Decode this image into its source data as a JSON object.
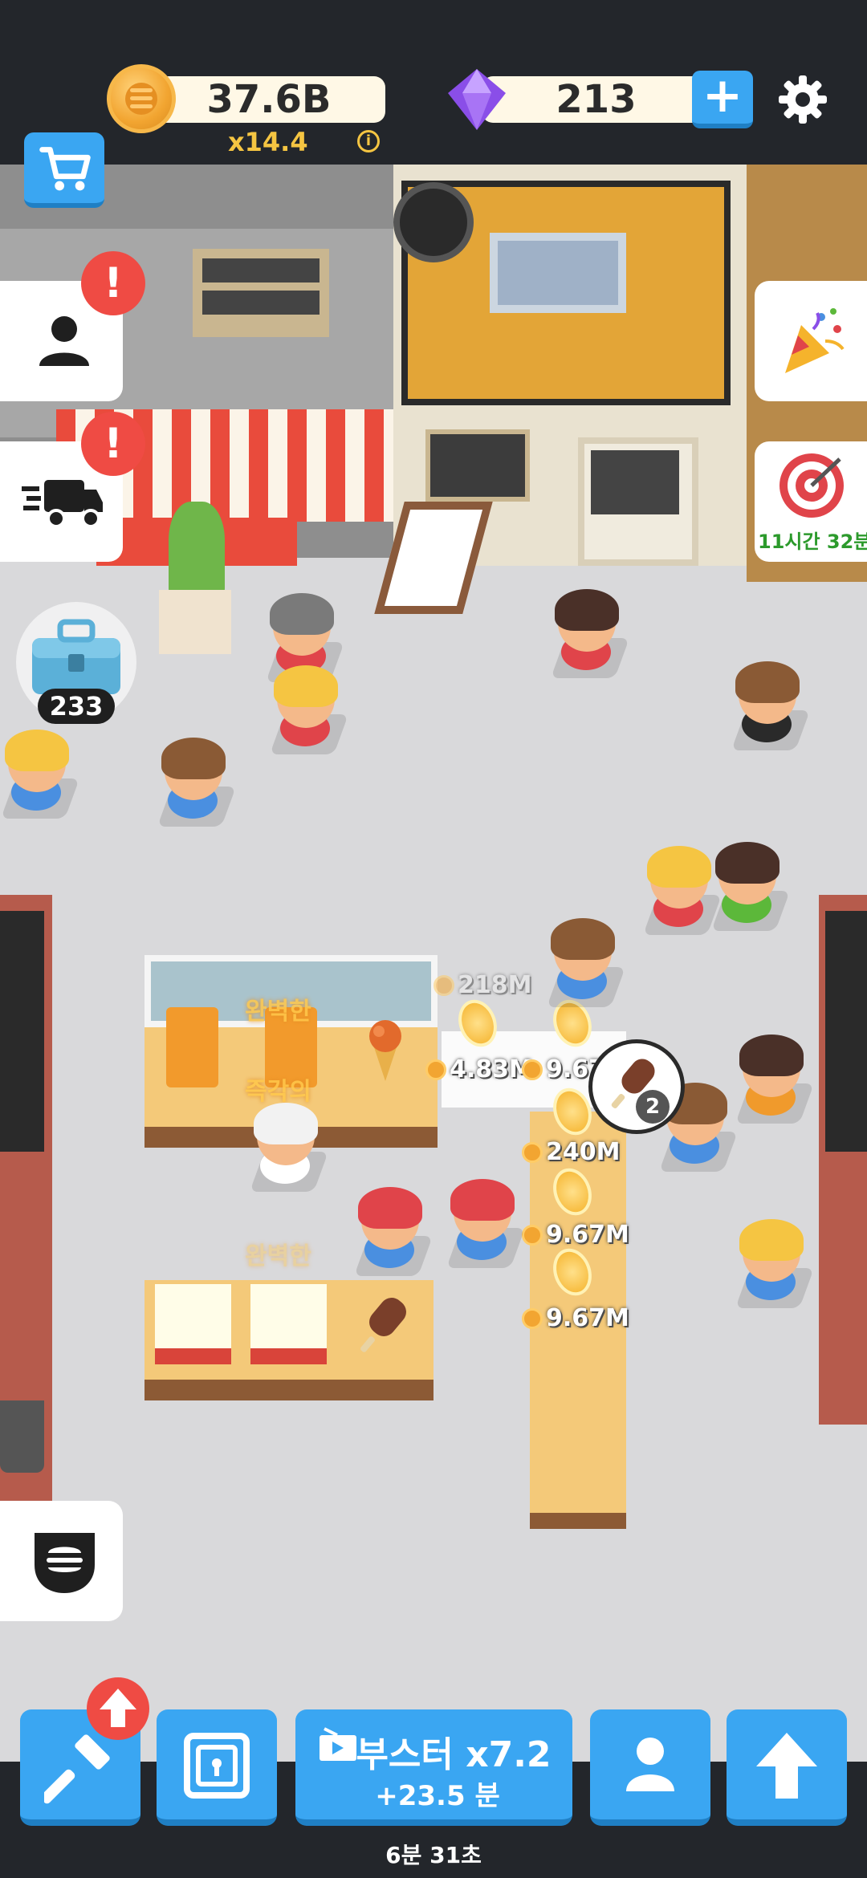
{
  "hud": {
    "coins": "37.6B",
    "multiplier": "x14.4",
    "info_symbol": "i",
    "gems": "213",
    "plus_label": "+"
  },
  "side_left": {
    "chest_count": "233"
  },
  "side_right": {
    "event_timer": "11시간 32분"
  },
  "scene": {
    "floating_texts": [
      "완벽한",
      "즉각의",
      "완벽한"
    ],
    "coin_labels": {
      "top_dim": "218M",
      "left_pile": "4.83M",
      "right_pile_1": "9.67M",
      "right_pile_2": "240M",
      "right_pile_3": "9.67M",
      "right_pile_4": "9.67M"
    },
    "order_count": "2"
  },
  "bottom": {
    "booster_label": "부스터 x7.2",
    "booster_time": "+23.5 분",
    "booster_countdown": "6분 31초"
  },
  "colors": {
    "accent_blue": "#3aa6f2",
    "alert_red": "#ef4b44",
    "coin_gold": "#f5c542",
    "background": "#23262b"
  },
  "icons": [
    "cart-icon",
    "settings-gear-icon",
    "gem-icon",
    "coin-icon",
    "profile-icon",
    "delivery-truck-icon",
    "party-popper-icon",
    "target-icon",
    "burger-icon",
    "hammer-icon",
    "vault-icon",
    "booster-ticket-icon",
    "staff-icon",
    "upgrade-arrow-icon"
  ]
}
